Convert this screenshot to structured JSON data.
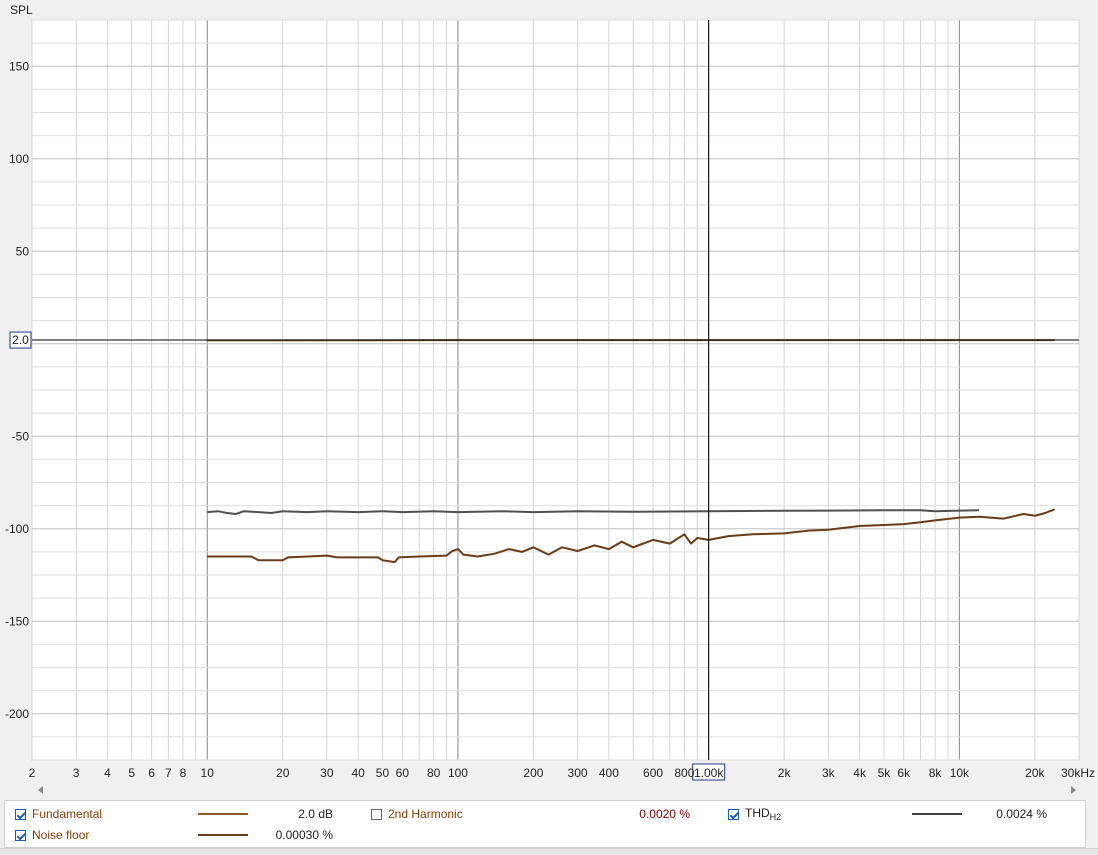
{
  "chart_data": {
    "type": "line",
    "ylabel": "SPL",
    "xlabel": "",
    "x_scale": "log",
    "xlim": [
      2,
      30000
    ],
    "ylim": [
      -225,
      175
    ],
    "x_ticks": [
      {
        "v": 2,
        "label": "2"
      },
      {
        "v": 3,
        "label": "3"
      },
      {
        "v": 4,
        "label": "4"
      },
      {
        "v": 5,
        "label": "5"
      },
      {
        "v": 6,
        "label": "6"
      },
      {
        "v": 7,
        "label": "7"
      },
      {
        "v": 8,
        "label": "8"
      },
      {
        "v": 10,
        "label": "10"
      },
      {
        "v": 20,
        "label": "20"
      },
      {
        "v": 30,
        "label": "30"
      },
      {
        "v": 40,
        "label": "40"
      },
      {
        "v": 50,
        "label": "50"
      },
      {
        "v": 60,
        "label": "60"
      },
      {
        "v": 80,
        "label": "80"
      },
      {
        "v": 100,
        "label": "100"
      },
      {
        "v": 200,
        "label": "200"
      },
      {
        "v": 300,
        "label": "300"
      },
      {
        "v": 400,
        "label": "400"
      },
      {
        "v": 600,
        "label": "600"
      },
      {
        "v": 800,
        "label": "800"
      },
      {
        "v": 2000,
        "label": "2k"
      },
      {
        "v": 3000,
        "label": "3k"
      },
      {
        "v": 4000,
        "label": "4k"
      },
      {
        "v": 5000,
        "label": "5k"
      },
      {
        "v": 6000,
        "label": "6k"
      },
      {
        "v": 8000,
        "label": "8k"
      },
      {
        "v": 10000,
        "label": "10k"
      },
      {
        "v": 20000,
        "label": "20k"
      },
      {
        "v": 30000,
        "label": "30kHz"
      }
    ],
    "y_ticks": [
      150,
      100,
      50,
      -50,
      -100,
      -150,
      -200
    ],
    "cursor": {
      "x": 1000,
      "y": 2.0,
      "x_label": "1.00k",
      "y_label": "2.0"
    },
    "grid": true,
    "series": [
      {
        "name": "Fundamental",
        "color": "#8b5a2b",
        "points": [
          [
            10,
            1.8
          ],
          [
            100,
            2.0
          ],
          [
            1000,
            2.0
          ],
          [
            10000,
            2.0
          ],
          [
            24000,
            2.0
          ]
        ]
      },
      {
        "name": "THD H2",
        "color": "#505050",
        "points": [
          [
            10,
            -91
          ],
          [
            11,
            -90.5
          ],
          [
            12,
            -91.5
          ],
          [
            13,
            -92
          ],
          [
            14,
            -90.5
          ],
          [
            16,
            -91
          ],
          [
            18,
            -91.5
          ],
          [
            20,
            -90.5
          ],
          [
            25,
            -91
          ],
          [
            30,
            -90.5
          ],
          [
            40,
            -91
          ],
          [
            50,
            -90.5
          ],
          [
            60,
            -91
          ],
          [
            80,
            -90.5
          ],
          [
            100,
            -91
          ],
          [
            150,
            -90.5
          ],
          [
            200,
            -91
          ],
          [
            300,
            -90.5
          ],
          [
            500,
            -90.8
          ],
          [
            1000,
            -90.5
          ],
          [
            2000,
            -90.3
          ],
          [
            3000,
            -90.2
          ],
          [
            5000,
            -90
          ],
          [
            7000,
            -90
          ],
          [
            8000,
            -90.5
          ],
          [
            10000,
            -90.2
          ],
          [
            12000,
            -90
          ]
        ]
      },
      {
        "name": "2nd Harmonic",
        "color": "#6b3b16",
        "points": [
          [
            10,
            -115
          ],
          [
            15,
            -115
          ],
          [
            16,
            -117
          ],
          [
            20,
            -117
          ],
          [
            21,
            -115.5
          ],
          [
            30,
            -114.5
          ],
          [
            33,
            -115.5
          ],
          [
            48,
            -115.5
          ],
          [
            50,
            -117
          ],
          [
            56,
            -118
          ],
          [
            58,
            -115.5
          ],
          [
            70,
            -115
          ],
          [
            90,
            -114.5
          ],
          [
            95,
            -112
          ],
          [
            100,
            -111
          ],
          [
            105,
            -114
          ],
          [
            120,
            -115
          ],
          [
            140,
            -113.5
          ],
          [
            160,
            -111
          ],
          [
            180,
            -112.5
          ],
          [
            200,
            -110
          ],
          [
            230,
            -114
          ],
          [
            260,
            -110
          ],
          [
            300,
            -112
          ],
          [
            350,
            -109
          ],
          [
            400,
            -111
          ],
          [
            450,
            -107
          ],
          [
            500,
            -110
          ],
          [
            600,
            -106
          ],
          [
            700,
            -108
          ],
          [
            800,
            -103
          ],
          [
            850,
            -108
          ],
          [
            900,
            -105
          ],
          [
            1000,
            -106
          ],
          [
            1200,
            -104
          ],
          [
            1500,
            -103
          ],
          [
            2000,
            -102.5
          ],
          [
            2500,
            -101
          ],
          [
            3000,
            -100.5
          ],
          [
            4000,
            -98.5
          ],
          [
            5000,
            -98
          ],
          [
            6000,
            -97.5
          ],
          [
            7000,
            -96.5
          ],
          [
            8000,
            -95.5
          ],
          [
            10000,
            -94
          ],
          [
            12000,
            -93.5
          ],
          [
            15000,
            -94.5
          ],
          [
            18000,
            -92
          ],
          [
            20000,
            -93
          ],
          [
            22000,
            -91.5
          ],
          [
            24000,
            -89.5
          ]
        ]
      }
    ]
  },
  "legend": {
    "fundamental_label": "Fundamental",
    "fundamental_value": "2.0 dB",
    "harmonic2_label": "2nd Harmonic",
    "harmonic2_value": "0.0020 %",
    "thd_label": "THD",
    "thd_sub": "H2",
    "thd_value": "0.0024 %",
    "noise_label": "Noise floor",
    "noise_value": "0.00030 %",
    "colors": {
      "fundamental": "#8b5a2b",
      "thd": "#404040",
      "noise": "#6b3b16"
    }
  }
}
